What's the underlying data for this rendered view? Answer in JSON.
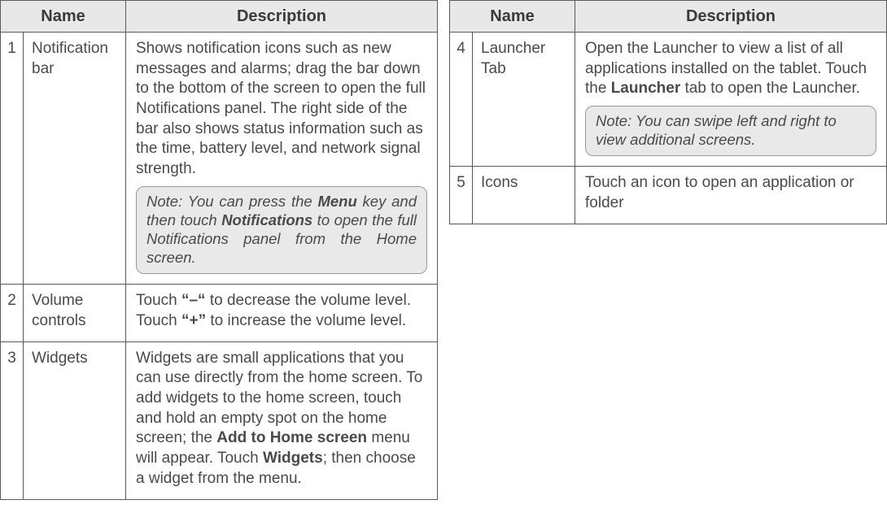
{
  "headers": {
    "name": "Name",
    "description": "Description"
  },
  "left": [
    {
      "idx": "1",
      "name": "Notification bar",
      "desc_segments": [
        {
          "t": "Shows notification icons such as new messages and alarms; drag the bar down to the bottom of the screen to open the full Notifications panel. The right side of the bar also shows status information such as the time, battery level, and network signal strength."
        }
      ],
      "note_segments": [
        {
          "t": "Note: You can press the "
        },
        {
          "t": "Menu",
          "b": true
        },
        {
          "t": " key and then touch "
        },
        {
          "t": "Notifications",
          "b": true
        },
        {
          "t": " to open the full Notifications panel from the Home screen."
        }
      ],
      "note_justify": true
    },
    {
      "idx": "2",
      "name": "Volume con­trols",
      "desc_segments": [
        {
          "t": "Touch "
        },
        {
          "t": "“–“",
          "b": true
        },
        {
          "t": " to decrease the volume level. Touch "
        },
        {
          "t": "“+”",
          "b": true
        },
        {
          "t": " to increase the vol­ume level."
        }
      ]
    },
    {
      "idx": "3",
      "name": "Widgets",
      "desc_segments": [
        {
          "t": "Widgets are small applications that you can use directly from the home screen. To add widgets to the home screen, touch and hold an empty spot on the home screen; the "
        },
        {
          "t": "Add to Home screen",
          "b": true
        },
        {
          "t": " menu will appear. Touch "
        },
        {
          "t": "Widgets",
          "b": true
        },
        {
          "t": "; then choose a widget from the menu."
        }
      ]
    }
  ],
  "right": [
    {
      "idx": "4",
      "name": "Launcher Tab",
      "desc_segments": [
        {
          "t": "Open the Launcher to view a list of all applications installed on the tablet. Touch the "
        },
        {
          "t": "Launcher",
          "b": true
        },
        {
          "t": " tab to open the Launcher."
        }
      ],
      "note_segments": [
        {
          "t": "Note: You can swipe left and right to view additional screens."
        }
      ]
    },
    {
      "idx": "5",
      "name": "Icons",
      "desc_segments": [
        {
          "t": "Touch an icon to open an application or folder"
        }
      ]
    }
  ]
}
